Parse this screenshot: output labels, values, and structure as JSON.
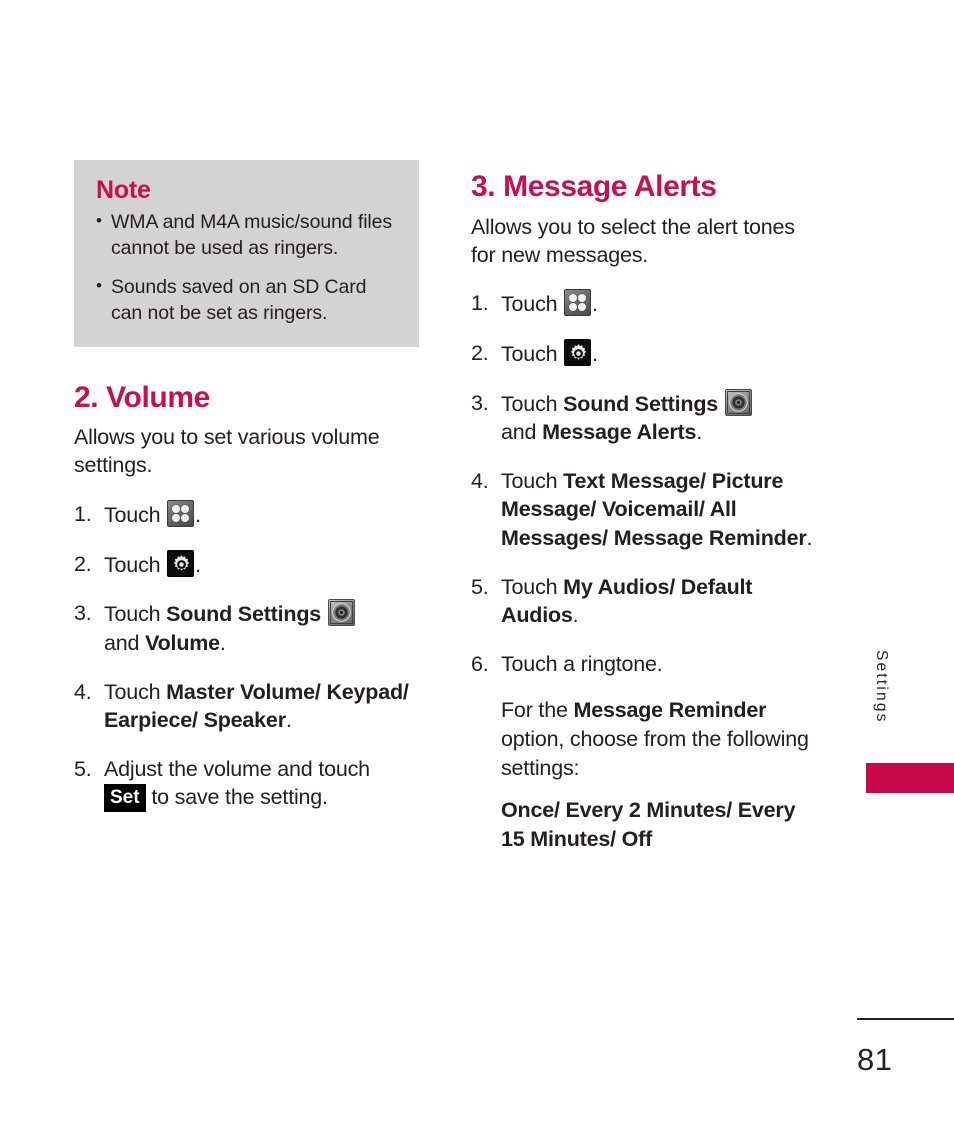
{
  "document": {
    "page_number": "81",
    "side_tab_label": "Settings",
    "accent_color": "#c8104e",
    "tab_block_color": "#c80a4b",
    "note_box_color": "#d3d3d3"
  },
  "note": {
    "title": "Note",
    "bullet_glyph": "•",
    "items": [
      "WMA and M4A music/sound files cannot be used as ringers.",
      "Sounds saved on an SD Card can not be set as ringers."
    ]
  },
  "left_column": {
    "heading": "2. Volume",
    "intro": "Allows you to set various volume settings.",
    "steps": [
      {
        "num": "1.",
        "text_before": "Touch",
        "icon": "grid-apps-icon",
        "text_after": "."
      },
      {
        "num": "2.",
        "text_before": "Touch",
        "icon": "gear-settings-icon",
        "text_after": "."
      },
      {
        "num": "3.",
        "text_before": "Touch",
        "bold_1": "Sound Settings",
        "icon": "speaker-sound-icon",
        "text_mid": "and",
        "bold_2": "Volume",
        "text_after": "."
      },
      {
        "num": "4.",
        "text_before": "Touch",
        "bold_1": "Master Volume/ Keypad/ Earpiece/ Speaker",
        "text_after": "."
      },
      {
        "num": "5.",
        "text_before": "Adjust the volume and touch",
        "key": "Set",
        "text_after": "to save the setting."
      }
    ]
  },
  "right_column": {
    "heading": "3. Message Alerts",
    "intro": "Allows you to select the alert tones for new messages.",
    "steps": [
      {
        "num": "1.",
        "text_before": "Touch",
        "icon": "grid-apps-icon",
        "text_after": "."
      },
      {
        "num": "2.",
        "text_before": "Touch",
        "icon": "gear-settings-icon",
        "text_after": "."
      },
      {
        "num": "3.",
        "text_before": "Touch",
        "bold_1": "Sound Settings",
        "icon": "speaker-sound-icon",
        "text_mid": "and",
        "bold_2": "Message Alerts",
        "text_after": "."
      },
      {
        "num": "4.",
        "text_before": "Touch",
        "bold_1": "Text Message/ Picture Message/ Voicemail/ All Messages/ Message Reminder",
        "text_after": "."
      },
      {
        "num": "5.",
        "text_before": "Touch",
        "bold_1": "My Audios/ Default Audios",
        "text_after": "."
      },
      {
        "num": "6.",
        "text_before": "Touch a ringtone.",
        "text_after": ""
      }
    ],
    "reminder_note": {
      "text_before": "For the",
      "bold_1": "Message Reminder",
      "text_after": "option, choose from the following settings:"
    },
    "reminder_options": "Once/ Every 2 Minutes/ Every 15 Minutes/ Off"
  }
}
